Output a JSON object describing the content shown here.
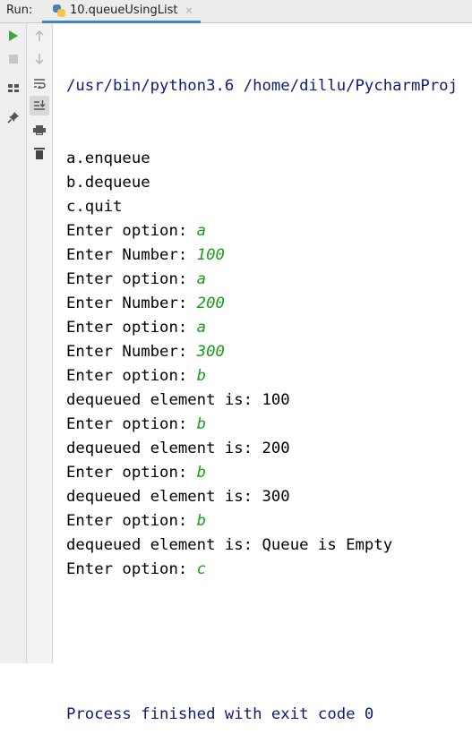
{
  "header": {
    "run_label": "Run:",
    "tab_title": "10.queueUsingList",
    "tab_close": "×"
  },
  "toolbar": {
    "left": [
      "run-icon",
      "stop-icon",
      "layout-icon",
      "pin-icon"
    ],
    "right": [
      "up-arrow-icon",
      "down-arrow-icon",
      "soft-wrap-icon",
      "scroll-to-end-icon",
      "print-icon",
      "trash-icon"
    ]
  },
  "console": {
    "command": "/usr/bin/python3.6 /home/dillu/PycharmProj",
    "lines": [
      {
        "text": "a.enqueue",
        "input": ""
      },
      {
        "text": "b.dequeue",
        "input": ""
      },
      {
        "text": "c.quit",
        "input": ""
      },
      {
        "text": "Enter option: ",
        "input": "a"
      },
      {
        "text": "Enter Number: ",
        "input": "100"
      },
      {
        "text": "Enter option: ",
        "input": "a"
      },
      {
        "text": "Enter Number: ",
        "input": "200"
      },
      {
        "text": "Enter option: ",
        "input": "a"
      },
      {
        "text": "Enter Number: ",
        "input": "300"
      },
      {
        "text": "Enter option: ",
        "input": "b"
      },
      {
        "text": "dequeued element is: 100",
        "input": ""
      },
      {
        "text": "Enter option: ",
        "input": "b"
      },
      {
        "text": "dequeued element is: 200",
        "input": ""
      },
      {
        "text": "Enter option: ",
        "input": "b"
      },
      {
        "text": "dequeued element is: 300",
        "input": ""
      },
      {
        "text": "Enter option: ",
        "input": "b"
      },
      {
        "text": "dequeued element is: Queue is Empty",
        "input": ""
      },
      {
        "text": "Enter option: ",
        "input": "c"
      }
    ],
    "exit_message": "Process finished with exit code 0"
  },
  "colors": {
    "output_text": "#000000",
    "system_text": "#0f1a7a",
    "user_input": "#1a9b1a",
    "tab_underline": "#4083c9"
  }
}
